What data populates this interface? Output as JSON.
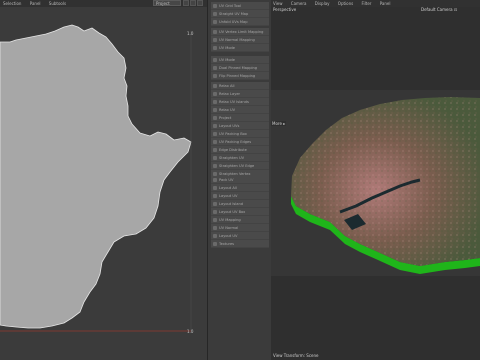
{
  "uv_editor": {
    "menu": [
      "Selection",
      "Panel",
      "Subtools"
    ],
    "dropdown_value": "Project",
    "coord_top": "1.0",
    "coord_bottom": "1.0"
  },
  "tool_panel": {
    "groups": [
      {
        "rows": [
          "UV Grid Tool",
          "Straight UV Map",
          "Unfold UVs Map"
        ]
      },
      {
        "rows": [
          "UV Vertex Limit Mapping",
          "UV Normal Mapping",
          "UV Mode"
        ]
      },
      {
        "rows": [
          "UV Mode",
          "Dual Pinned Mapping",
          "Flip Pinned Mapping"
        ]
      },
      {
        "rows": [
          "Relax All",
          "Relax Layer",
          "Relax UV Islands"
        ]
      },
      {
        "rows": [
          "Relax UV",
          "Project",
          "Layout UVs",
          "UV Packing Box",
          "UV Packing Edges",
          "Edge Distribute",
          "Straighten UV",
          "Straighten UV Edge",
          "Straighten Vertex"
        ]
      },
      {
        "rows": [
          "Pack UV",
          "Layout All",
          "Layout UV",
          "Layout Island",
          "Layout UV Box",
          "UV Mapping",
          "UV Normal",
          "Layout UV",
          "Textures"
        ]
      }
    ]
  },
  "viewport": {
    "menu": [
      "View",
      "Camera",
      "Display",
      "Options",
      "Filter",
      "Panel"
    ],
    "label": "Perspective",
    "camera": "Default Camera ⊡",
    "more": "More ▸",
    "status": "View Transform: Scene"
  },
  "colors": {
    "uv_fill": "#a7a7a7",
    "uv_bg": "#3b3b3b",
    "terrain_side": "#1fb51a",
    "accent_red": "#c0392b"
  }
}
